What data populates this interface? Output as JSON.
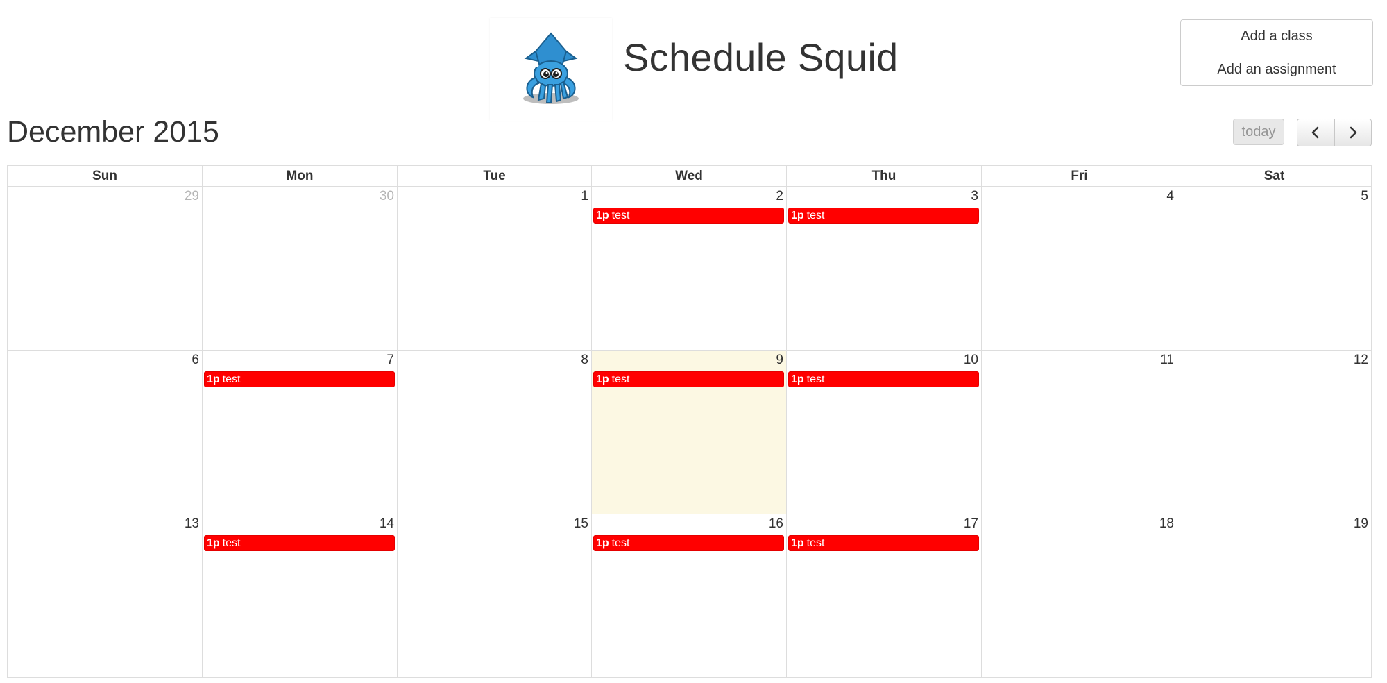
{
  "app": {
    "title": "Schedule Squid",
    "logo_icon": "squid-icon"
  },
  "actions": {
    "add_class": "Add a class",
    "add_assignment": "Add an assignment"
  },
  "toolbar": {
    "title": "December 2015",
    "today_label": "today",
    "prev_icon": "chevron-left-icon",
    "next_icon": "chevron-right-icon"
  },
  "colors": {
    "event": "#ff0000",
    "today_bg": "#fcf8e3",
    "text": "#333333",
    "other_month": "#b5b5b5"
  },
  "calendar": {
    "day_headers": [
      "Sun",
      "Mon",
      "Tue",
      "Wed",
      "Thu",
      "Fri",
      "Sat"
    ],
    "weeks": [
      [
        {
          "num": "29",
          "other": true
        },
        {
          "num": "30",
          "other": true
        },
        {
          "num": "1"
        },
        {
          "num": "2",
          "event": {
            "time": "1p",
            "title": "test"
          }
        },
        {
          "num": "3",
          "event": {
            "time": "1p",
            "title": "test"
          }
        },
        {
          "num": "4"
        },
        {
          "num": "5"
        }
      ],
      [
        {
          "num": "6"
        },
        {
          "num": "7",
          "event": {
            "time": "1p",
            "title": "test"
          }
        },
        {
          "num": "8"
        },
        {
          "num": "9",
          "today": true,
          "event": {
            "time": "1p",
            "title": "test"
          }
        },
        {
          "num": "10",
          "event": {
            "time": "1p",
            "title": "test"
          }
        },
        {
          "num": "11"
        },
        {
          "num": "12"
        }
      ],
      [
        {
          "num": "13"
        },
        {
          "num": "14",
          "event": {
            "time": "1p",
            "title": "test"
          }
        },
        {
          "num": "15"
        },
        {
          "num": "16",
          "event": {
            "time": "1p",
            "title": "test"
          }
        },
        {
          "num": "17",
          "event": {
            "time": "1p",
            "title": "test"
          }
        },
        {
          "num": "18"
        },
        {
          "num": "19"
        }
      ]
    ]
  }
}
